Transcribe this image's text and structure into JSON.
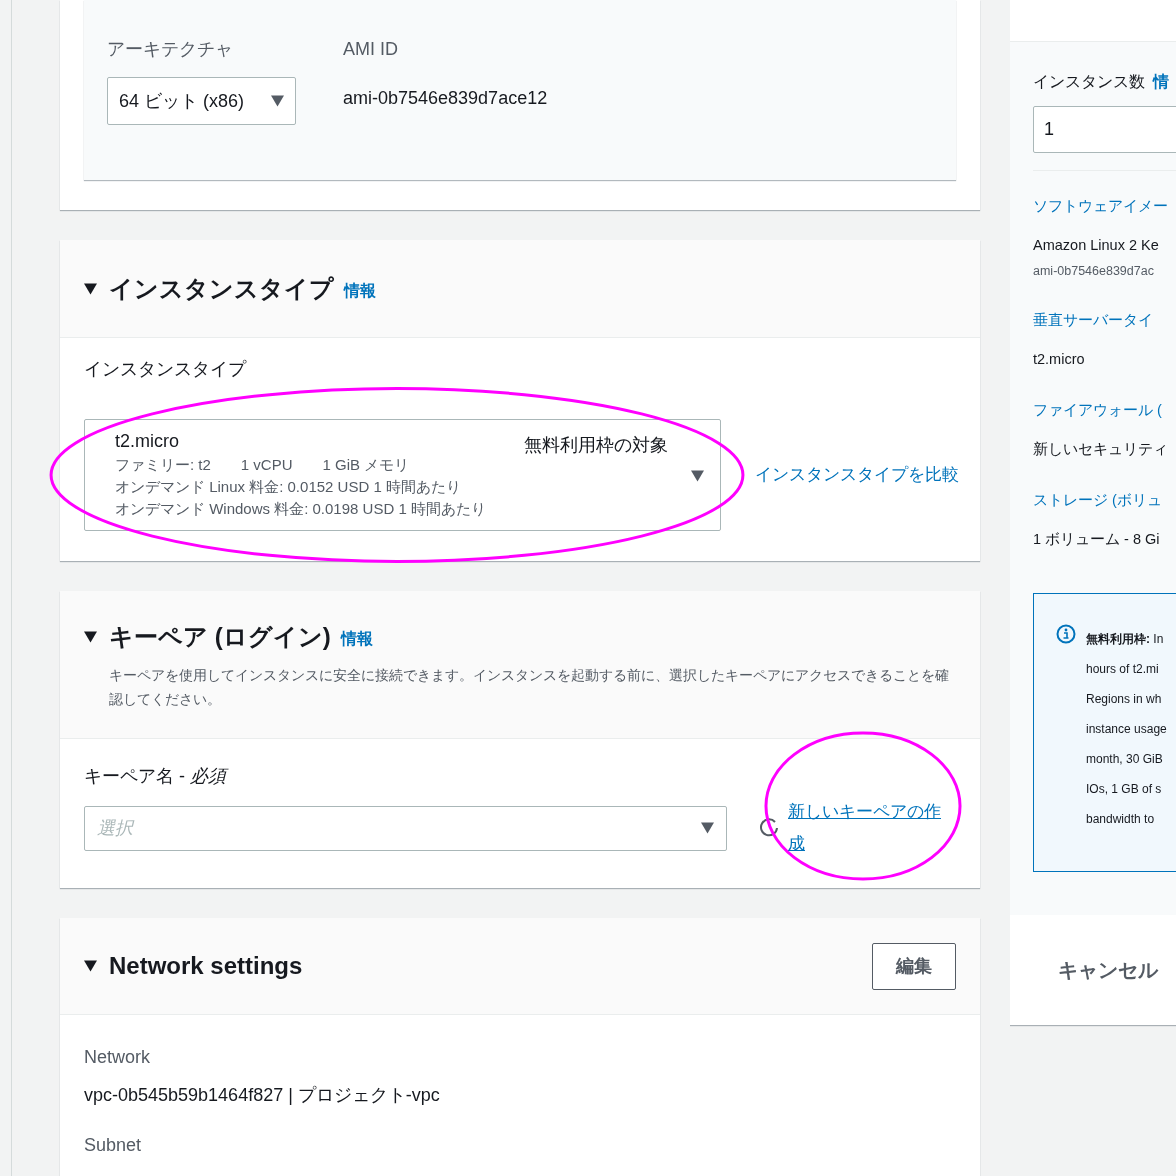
{
  "ami_panel": {
    "architecture": {
      "label": "アーキテクチャ",
      "value": "64 ビット (x86)"
    },
    "ami_id": {
      "label": "AMI ID",
      "value": "ami-0b7546e839d7ace12"
    }
  },
  "instance_type": {
    "title": "インスタンスタイプ",
    "info": "情報",
    "expanded": true,
    "field_label": "インスタンスタイプ",
    "name": "t2.micro",
    "badge": "無料利用枠の対象",
    "details": [
      "ファミリー: t2　　1 vCPU　　1 GiB メモリ",
      "オンデマンド Linux 料金: 0.0152 USD 1 時間あたり",
      "オンデマンド Windows 料金: 0.0198 USD 1 時間あたり"
    ],
    "compare_link": "インスタンスタイプを比較",
    "highlighted": true
  },
  "key_pair": {
    "title": "キーペア (ログイン)",
    "info": "情報",
    "expanded": true,
    "description": "キーペアを使用してインスタンスに安全に接続できます。インスタンスを起動する前に、選択したキーペアにアクセスできることを確認してください。",
    "field_label": "キーペア名 - *必須*",
    "placeholder": "選択",
    "create_link": "新しいキーペアの作成",
    "highlighted": true
  },
  "network_settings": {
    "title": "Network settings",
    "expanded": true,
    "edit_button": "編集",
    "fields": [
      {
        "label": "Network",
        "value": "vpc-0b545b59b1464f827 | プロジェクト-vpc"
      },
      {
        "label": "Subnet"
      }
    ]
  },
  "summary": {
    "count_label": "インスタンス数",
    "info": "情",
    "count_value": "1",
    "items": [
      {
        "title": "ソフトウェアイメー",
        "value": "Amazon Linux 2 Ke",
        "sub": "ami-0b7546e839d7ac"
      },
      {
        "title": "垂直サーバータイ",
        "value": "t2.micro"
      },
      {
        "title": "ファイアウォール (",
        "value": "新しいセキュリティ"
      },
      {
        "title": "ストレージ (ボリュ",
        "value": "1 ボリューム - 8 Gi"
      }
    ],
    "free_tier_lines": [
      "**無料利用枠:** In",
      "hours of t2.mi",
      "Regions in wh",
      "instance usage",
      "month, 30 GiB",
      "IOs, 1 GB of s",
      "bandwidth to"
    ],
    "cancel_button": "キャンセル"
  }
}
